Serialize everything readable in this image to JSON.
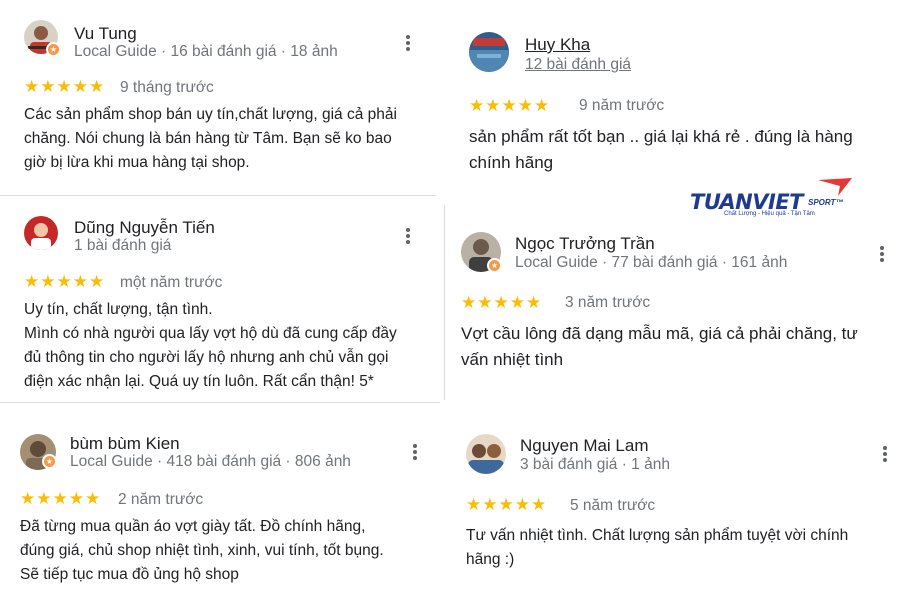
{
  "reviews": [
    {
      "name": "Vu Tung",
      "meta": "Local Guide · 16 bài đánh giá · 18 ảnh",
      "stars": "★★★★★",
      "when": "9 tháng trước",
      "lines": [
        "Các sản phẩm shop bán uy tín,chất lượng, giá cả phải",
        "chăng. Nói chung là bán hàng từ Tâm. Bạn sẽ ko bao",
        "giờ bị lừa khi mua hàng tại shop."
      ]
    },
    {
      "name": "Huy Kha",
      "meta": "12 bài đánh giá",
      "stars": "★★★★★",
      "when": "9 năm trước",
      "lines": [
        "sản phẩm rất tốt bạn .. giá lại khá rẻ . đúng là hàng",
        "chính hãng"
      ]
    },
    {
      "name": "Dũng Nguyễn Tiến",
      "meta": "1 bài đánh giá",
      "stars": "★★★★★",
      "when": "một năm trước",
      "lines": [
        "Uy tín, chất lượng, tận tình.",
        "Mình có nhà người qua lấy vợt hộ dù đã cung cấp đầy",
        "đủ thông tin cho người lấy hộ nhưng anh chủ vẫn gọi",
        "điện xác nhận lại. Quá uy tín luôn. Rất cẩn thận! 5*"
      ]
    },
    {
      "name": "Ngọc Trưởng Trần",
      "meta": "Local Guide · 77 bài đánh giá · 161 ảnh",
      "stars": "★★★★★",
      "when": "3 năm trước",
      "lines": [
        "Vợt cầu lông đã dạng mẫu mã, giá cả phải chăng, tư",
        "vấn nhiệt tình"
      ]
    },
    {
      "name": "bùm bùm Kien",
      "meta": "Local Guide · 418 bài đánh giá · 806 ảnh",
      "stars": "★★★★★",
      "when": "2 năm trước",
      "lines": [
        "Đã từng mua quần áo vợt giày tất. Đồ chính hãng,",
        "đúng giá, chủ shop nhiệt tình, xinh, vui tính, tốt bụng.",
        "Sẽ tiếp tục mua đồ ủng hộ shop"
      ]
    },
    {
      "name": "Nguyen Mai Lam",
      "meta": "3 bài đánh giá · 1 ảnh",
      "stars": "★★★★★",
      "when": "5 năm trước",
      "lines": [
        "Tư vấn nhiệt tình. Chất lượng sản phẩm tuyệt vời chính",
        "hãng :)"
      ]
    }
  ],
  "logo": {
    "main": "TUANVIET",
    "sport": "SPORT™",
    "tagline": "Chất Lượng - Hiệu quả - Tận Tâm"
  },
  "colors": {
    "star": "#fbbc04",
    "badge": "#f2994a",
    "logo": "#1f3b8f",
    "logo_accent": "#e53935"
  },
  "icons": [
    "more-vertical-icon",
    "star-icon",
    "local-guide-badge-icon"
  ]
}
